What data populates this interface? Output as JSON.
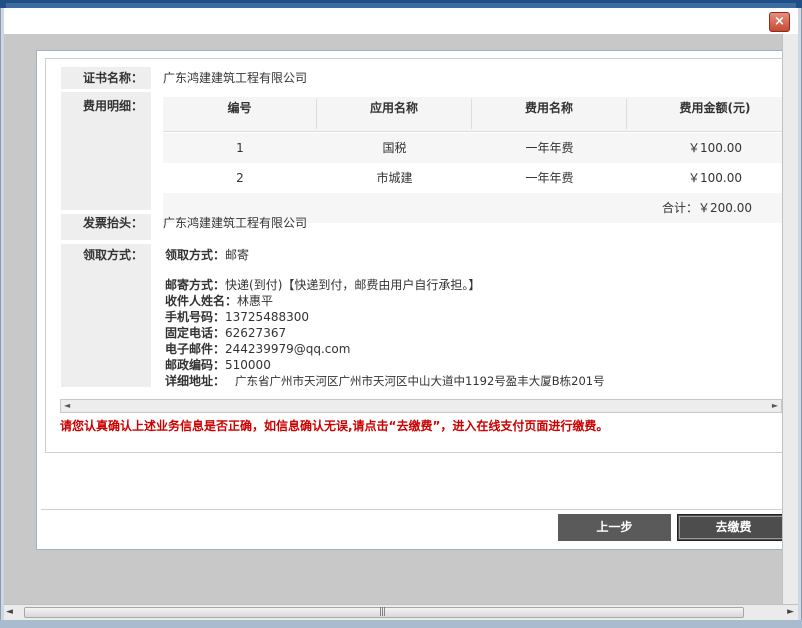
{
  "window": {
    "close_icon": "close-icon",
    "close_glyph": "×"
  },
  "form": {
    "cert_name_label": "证书名称：",
    "cert_name_value": "广东鸿建建筑工程有限公司",
    "fee_detail_label": "费用明细：",
    "invoice_title_label": "发票抬头：",
    "invoice_title_value": "广东鸿建建筑工程有限公司",
    "pickup_label": "领取方式："
  },
  "fee_table": {
    "headers": [
      "编号",
      "应用名称",
      "费用名称",
      "费用金额(元)"
    ],
    "rows": [
      {
        "no": "1",
        "app": "国税",
        "fee": "一年年费",
        "amount": "￥100.00"
      },
      {
        "no": "2",
        "app": "市城建",
        "fee": "一年年费",
        "amount": "￥100.00"
      }
    ],
    "total": "合计：￥200.00"
  },
  "pickup": {
    "method_label": "领取方式：",
    "method_value": "邮寄",
    "mail_method_label": "邮寄方式：",
    "mail_method_value": "快递(到付)【快递到付，邮费由用户自行承担。】",
    "recipient_label": "收件人姓名：",
    "recipient_value": "林惠平",
    "mobile_label": "手机号码：",
    "mobile_value": "13725488300",
    "phone_label": "固定电话：",
    "phone_value": "62627367",
    "email_label": "电子邮件：",
    "email_value": "244239979@qq.com",
    "postcode_label": "邮政编码：",
    "postcode_value": "510000",
    "address_label": "详细地址：",
    "address_value": "广东省广州市天河区广州市天河区中山大道中1192号盈丰大厦B栋201号"
  },
  "hint": "请您认真确认上述业务信息是否正确，如信息确认无误,请点击“去缴费”，进入在线支付页面进行缴费。",
  "buttons": {
    "prev": "上一步",
    "pay": "去缴费"
  },
  "scrollbar": {
    "left_arrow": "◄",
    "right_arrow": "►",
    "grip": "|||"
  },
  "colors": {
    "hint": "#cc0000",
    "button": "#5a5a5a",
    "close": "#c44a35"
  }
}
